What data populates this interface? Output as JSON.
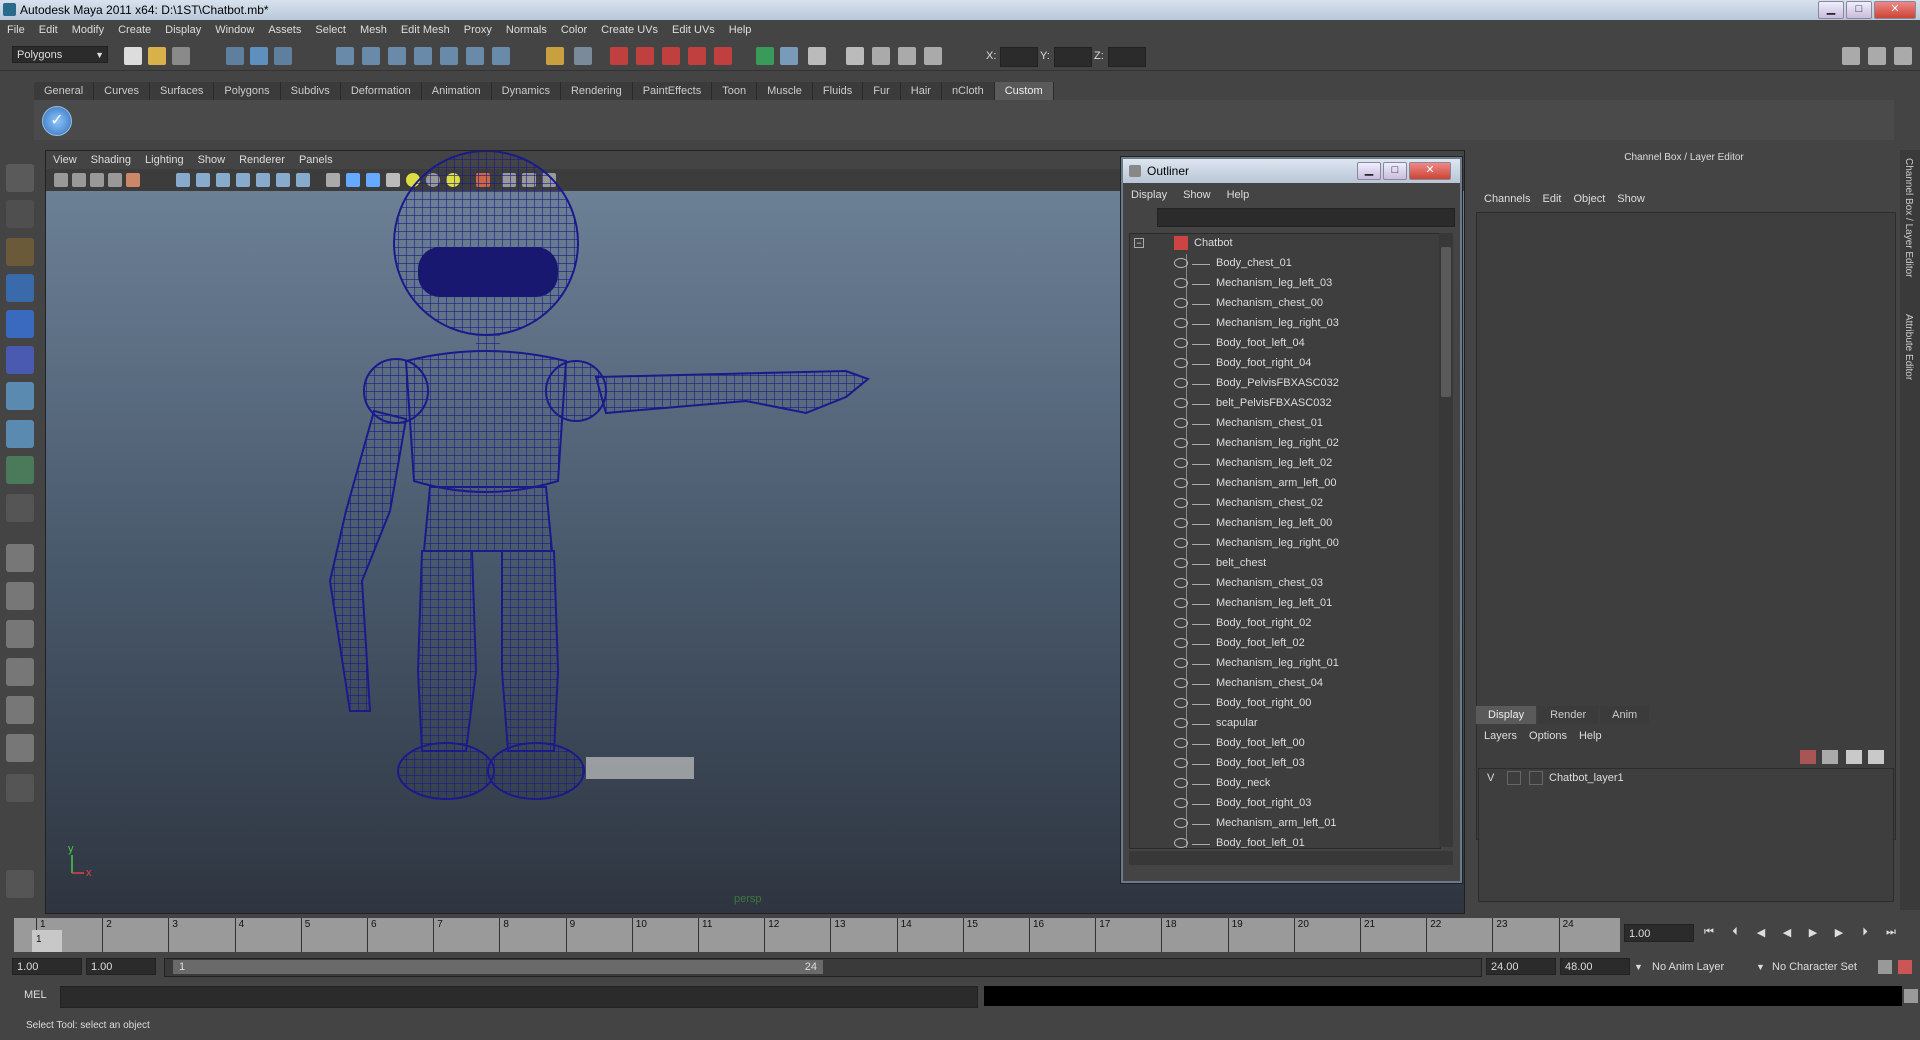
{
  "window": {
    "title": "Autodesk Maya 2011 x64: D:\\1ST\\Chatbot.mb*",
    "minimize": "▁",
    "maximize": "□",
    "close": "✕"
  },
  "menubar": [
    "File",
    "Edit",
    "Modify",
    "Create",
    "Display",
    "Window",
    "Assets",
    "Select",
    "Mesh",
    "Edit Mesh",
    "Proxy",
    "Normals",
    "Color",
    "Create UVs",
    "Edit UVs",
    "Help"
  ],
  "statusline": {
    "mode": "Polygons",
    "x_label": "X:",
    "y_label": "Y:",
    "z_label": "Z:"
  },
  "shelf": {
    "tabs": [
      "General",
      "Curves",
      "Surfaces",
      "Polygons",
      "Subdivs",
      "Deformation",
      "Animation",
      "Dynamics",
      "Rendering",
      "PaintEffects",
      "Toon",
      "Muscle",
      "Fluids",
      "Fur",
      "Hair",
      "nCloth",
      "Custom"
    ],
    "active": "Custom"
  },
  "viewport": {
    "menu": [
      "View",
      "Shading",
      "Lighting",
      "Show",
      "Renderer",
      "Panels"
    ],
    "camera": "persp",
    "axis_y": "y",
    "axis_x": "x"
  },
  "outliner": {
    "title": "Outliner",
    "menu": [
      "Display",
      "Show",
      "Help"
    ],
    "root": "Chatbot",
    "items": [
      "Body_chest_01",
      "Mechanism_leg_left_03",
      "Mechanism_chest_00",
      "Mechanism_leg_right_03",
      "Body_foot_left_04",
      "Body_foot_right_04",
      "Body_PelvisFBXASC032",
      "belt_PelvisFBXASC032",
      "Mechanism_chest_01",
      "Mechanism_leg_right_02",
      "Mechanism_leg_left_02",
      "Mechanism_arm_left_00",
      "Mechanism_chest_02",
      "Mechanism_leg_left_00",
      "Mechanism_leg_right_00",
      "belt_chest",
      "Mechanism_chest_03",
      "Mechanism_leg_left_01",
      "Body_foot_right_02",
      "Body_foot_left_02",
      "Mechanism_leg_right_01",
      "Mechanism_chest_04",
      "Body_foot_right_00",
      "scapular",
      "Body_foot_left_00",
      "Body_foot_left_03",
      "Body_neck",
      "Body_foot_right_03",
      "Mechanism_arm_left_01",
      "Body_foot_left_01"
    ]
  },
  "channelbox": {
    "title": "Channel Box / Layer Editor",
    "menu": [
      "Channels",
      "Edit",
      "Object",
      "Show"
    ],
    "layer_tabs": [
      "Display",
      "Render",
      "Anim"
    ],
    "layer_menu": [
      "Layers",
      "Options",
      "Help"
    ],
    "layer": {
      "visible": "V",
      "name": "Chatbot_layer1"
    },
    "side_tabs": [
      "Channel Box / Layer Editor",
      "Attribute Editor"
    ]
  },
  "timeslider": {
    "ticks": [
      "1",
      "2",
      "3",
      "4",
      "5",
      "6",
      "7",
      "8",
      "9",
      "10",
      "11",
      "12",
      "13",
      "14",
      "15",
      "16",
      "17",
      "18",
      "19",
      "20",
      "21",
      "22",
      "23",
      "24"
    ],
    "current_marker": "1",
    "current_frame": "1.00"
  },
  "range": {
    "start": "1.00",
    "playback_start": "1.00",
    "thumb_start": "1",
    "thumb_end": "24",
    "playback_end": "24.00",
    "end": "48.00",
    "anim_layer": "No Anim Layer",
    "char_set": "No Character Set"
  },
  "cmdline": {
    "label": "MEL"
  },
  "helpline": {
    "text": "Select Tool: select an object"
  },
  "colors": {
    "wireframe": "#1a1a8c",
    "bg_top": "#6f849a",
    "bg_bottom": "#2e3540"
  }
}
